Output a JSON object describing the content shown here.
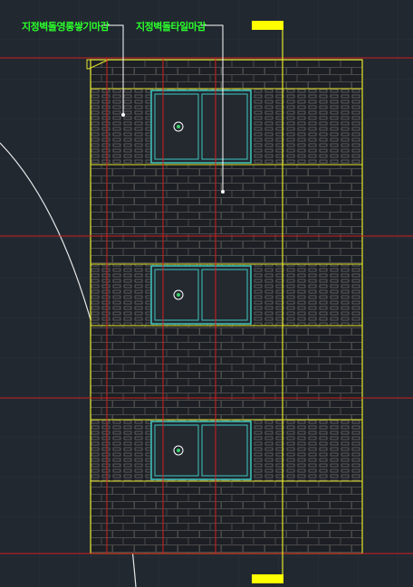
{
  "drawing": {
    "background": "#212830",
    "grid_color": "#2c3440",
    "axis_color": "#d02020",
    "outline_color": "#e6e62a",
    "brick_color": "#4a4a4a",
    "window_frame_color": "#3ec8c0",
    "leader_color": "#ffffff",
    "arc_color": "#e8e8e8",
    "marker_color": "#ffff00",
    "window_symbol_color": "#3cd06a"
  },
  "annotations": [
    {
      "text": "지정벽돌영롱쌓기마감"
    },
    {
      "text": "지정벽돌타일마감"
    }
  ],
  "elevation": {
    "floors": 3,
    "windows_per_floor": 1,
    "window_panes": 2
  }
}
